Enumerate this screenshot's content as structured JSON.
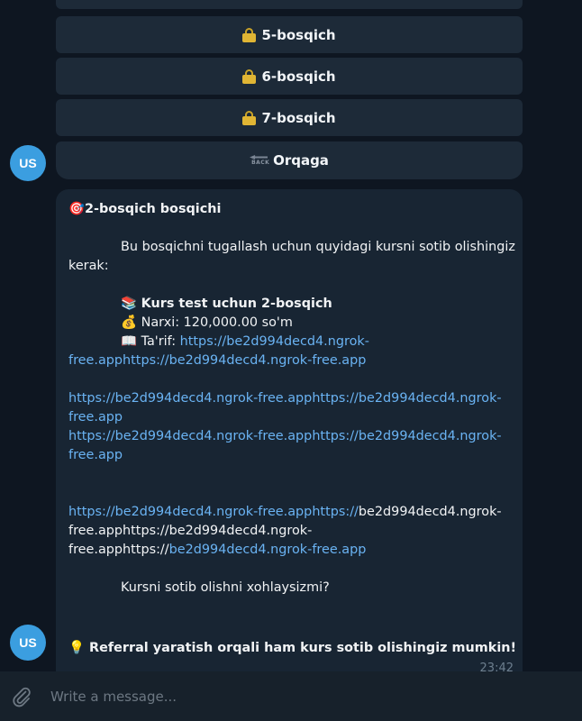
{
  "keyboard": {
    "buttons": [
      {
        "label": "5-bosqich",
        "icon": "lock-icon"
      },
      {
        "label": "6-bosqich",
        "icon": "lock-icon"
      },
      {
        "label": "7-bosqich",
        "icon": "lock-icon"
      },
      {
        "label": "Orqaga",
        "icon": "back-icon"
      }
    ]
  },
  "avatar": {
    "initials": "US",
    "color": "#3b9ee0"
  },
  "message": {
    "title_emoji": "🎯",
    "title": "2-bosqich bosqichi",
    "intro_line1": "Bu bosqichni tugallash uchun quyidagi kursni sotib olishingiz",
    "intro_line2": "kerak:",
    "course_emoji": "📚",
    "course_name": "Kurs test uchun 2-bosqich",
    "price_emoji": "💰",
    "price": "Narxi: 120,000.00 so'm",
    "desc_emoji": "📖",
    "desc_label": "Ta'rif:",
    "desc_link_1": "https://be2d994decd4.ngrok-",
    "desc_link_2a": "free.apphttps://",
    "desc_link_2b": "be2d994decd4.ngrok-free.app",
    "links_block": [
      "https://be2d994decd4.ngrok-free.apphttps://be2d994decd4.ngrok-",
      "free.app",
      "https://be2d994decd4.ngrok-free.apphttps://be2d994decd4.ngrok-",
      "free.app"
    ],
    "last_link_1a": "https://be2d994decd4.ngrok-free.apphttps://",
    "last_link_1b": "be2d994decd4.ngrok-",
    "last_link_2": "free.apphttps://be2d994decd4.ngrok-",
    "last_link_3a": "free.apphttps://",
    "last_link_3b": "be2d994decd4.ngrok-free.app",
    "question": "Kursni sotib olishni xohlaysizmi?"
  },
  "tip": {
    "emoji": "💡",
    "text": "Referral yaratish orqali ham kurs sotib olishingiz mumkin!",
    "time": "23:42"
  },
  "input": {
    "placeholder": "Write a message..."
  },
  "colors": {
    "background": "#0e1621",
    "bubble": "#182533",
    "link": "#6ab3f3",
    "button": "#1d2a38"
  }
}
